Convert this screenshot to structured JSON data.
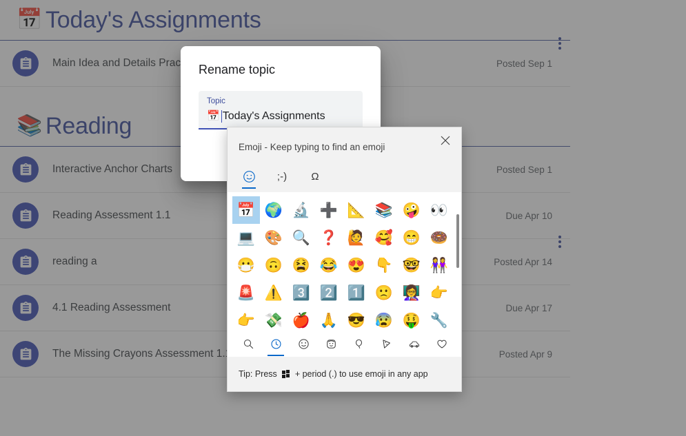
{
  "page": {
    "sections": [
      {
        "emoji": "📅",
        "emoji_name": "calendar-emoji",
        "title": "Today's Assignments",
        "menu_name": "section-menu",
        "rows": [
          {
            "icon": "assignment-icon",
            "title": "Main Idea and Details Practice",
            "date": "Posted Sep 1"
          }
        ]
      },
      {
        "emoji": "📚",
        "emoji_name": "books-emoji",
        "title": "Reading",
        "menu_name": "section-menu",
        "rows": [
          {
            "icon": "assignment-icon",
            "title": "Interactive Anchor Charts",
            "date": "Posted Sep 1"
          },
          {
            "icon": "assignment-icon",
            "title": "Reading Assessment 1.1",
            "date": "Due Apr 10"
          },
          {
            "icon": "assignment-icon",
            "title": "reading a",
            "date": "Posted Apr 14"
          },
          {
            "icon": "assignment-icon",
            "title": "4.1 Reading Assessment",
            "date": "Due Apr 17"
          },
          {
            "icon": "assignment-icon",
            "title": "The Missing Crayons Assessment 1.1",
            "date": "Posted Apr 9"
          }
        ]
      }
    ]
  },
  "rename_dialog": {
    "title": "Rename topic",
    "field_label": "Topic",
    "field_emoji": "📅",
    "field_value": "Today's Assignments"
  },
  "emoji_panel": {
    "hint": "Emoji - Keep typing to find an emoji",
    "close_label": "✕",
    "tabs": [
      {
        "name": "tab-emoji",
        "glyph": "emoji-face-icon",
        "active": true
      },
      {
        "name": "tab-kaomoji",
        "glyph": ";-)",
        "active": false
      },
      {
        "name": "tab-symbols",
        "glyph": "Ω",
        "active": false
      }
    ],
    "grid": [
      {
        "char": "📅",
        "name": "calendar-emoji",
        "selected": true
      },
      {
        "char": "🌍",
        "name": "globe-europe-africa-emoji",
        "selected": false
      },
      {
        "char": "🔬",
        "name": "microscope-emoji",
        "selected": false
      },
      {
        "char": "➕",
        "name": "plus-sign-emoji",
        "selected": false
      },
      {
        "char": "📐",
        "name": "triangular-ruler-emoji",
        "selected": false
      },
      {
        "char": "📚",
        "name": "books-emoji",
        "selected": false
      },
      {
        "char": "🤪",
        "name": "zany-face-emoji",
        "selected": false
      },
      {
        "char": "👀",
        "name": "eyes-emoji",
        "selected": false
      },
      {
        "char": "💻",
        "name": "laptop-emoji",
        "selected": false
      },
      {
        "char": "🎨",
        "name": "artist-palette-emoji",
        "selected": false
      },
      {
        "char": "🔍",
        "name": "magnifying-glass-emoji",
        "selected": false
      },
      {
        "char": "❓",
        "name": "question-mark-emoji",
        "selected": false
      },
      {
        "char": "🙋",
        "name": "person-raising-hand-emoji",
        "selected": false
      },
      {
        "char": "🥰",
        "name": "smiling-face-with-hearts-emoji",
        "selected": false
      },
      {
        "char": "😁",
        "name": "beaming-face-emoji",
        "selected": false
      },
      {
        "char": "🍩",
        "name": "doughnut-emoji",
        "selected": false
      },
      {
        "char": "😷",
        "name": "face-with-medical-mask-emoji",
        "selected": false
      },
      {
        "char": "🙃",
        "name": "upside-down-face-emoji",
        "selected": false
      },
      {
        "char": "😫",
        "name": "tired-face-emoji",
        "selected": false
      },
      {
        "char": "😂",
        "name": "face-with-tears-of-joy-emoji",
        "selected": false
      },
      {
        "char": "😍",
        "name": "smiling-face-with-heart-eyes-emoji",
        "selected": false
      },
      {
        "char": "👇",
        "name": "backhand-index-pointing-down-emoji",
        "selected": false
      },
      {
        "char": "🤓",
        "name": "nerd-face-emoji",
        "selected": false
      },
      {
        "char": "👭",
        "name": "women-holding-hands-emoji",
        "selected": false
      },
      {
        "char": "🚨",
        "name": "police-car-light-emoji",
        "selected": false
      },
      {
        "char": "⚠️",
        "name": "warning-emoji",
        "selected": false
      },
      {
        "char": "3️⃣",
        "name": "keycap-three-emoji",
        "selected": false
      },
      {
        "char": "2️⃣",
        "name": "keycap-two-emoji",
        "selected": false
      },
      {
        "char": "1️⃣",
        "name": "keycap-one-emoji",
        "selected": false
      },
      {
        "char": "🙁",
        "name": "slightly-frowning-face-emoji",
        "selected": false
      },
      {
        "char": "👩‍🏫",
        "name": "woman-teacher-emoji",
        "selected": false
      },
      {
        "char": "👉",
        "name": "backhand-index-pointing-right-emoji",
        "selected": false
      },
      {
        "char": "👉",
        "name": "backhand-index-pointing-right-emoji",
        "selected": false
      },
      {
        "char": "💸",
        "name": "money-with-wings-emoji",
        "selected": false
      },
      {
        "char": "🍎",
        "name": "red-apple-emoji",
        "selected": false
      },
      {
        "char": "🙏",
        "name": "folded-hands-emoji",
        "selected": false
      },
      {
        "char": "😎",
        "name": "smiling-face-with-sunglasses-emoji",
        "selected": false
      },
      {
        "char": "😰",
        "name": "anxious-face-with-sweat-emoji",
        "selected": false
      },
      {
        "char": "🤑",
        "name": "money-mouth-face-emoji",
        "selected": false
      },
      {
        "char": "🔧",
        "name": "wrench-emoji",
        "selected": false
      }
    ],
    "categories": [
      {
        "name": "category-search",
        "active": false
      },
      {
        "name": "category-recent",
        "active": true
      },
      {
        "name": "category-smileys",
        "active": false
      },
      {
        "name": "category-people",
        "active": false
      },
      {
        "name": "category-celebration",
        "active": false
      },
      {
        "name": "category-food",
        "active": false
      },
      {
        "name": "category-travel",
        "active": false
      },
      {
        "name": "category-symbols",
        "active": false
      }
    ],
    "tip_prefix": "Tip: Press",
    "tip_suffix": "+ period (.) to use emoji in any app"
  }
}
